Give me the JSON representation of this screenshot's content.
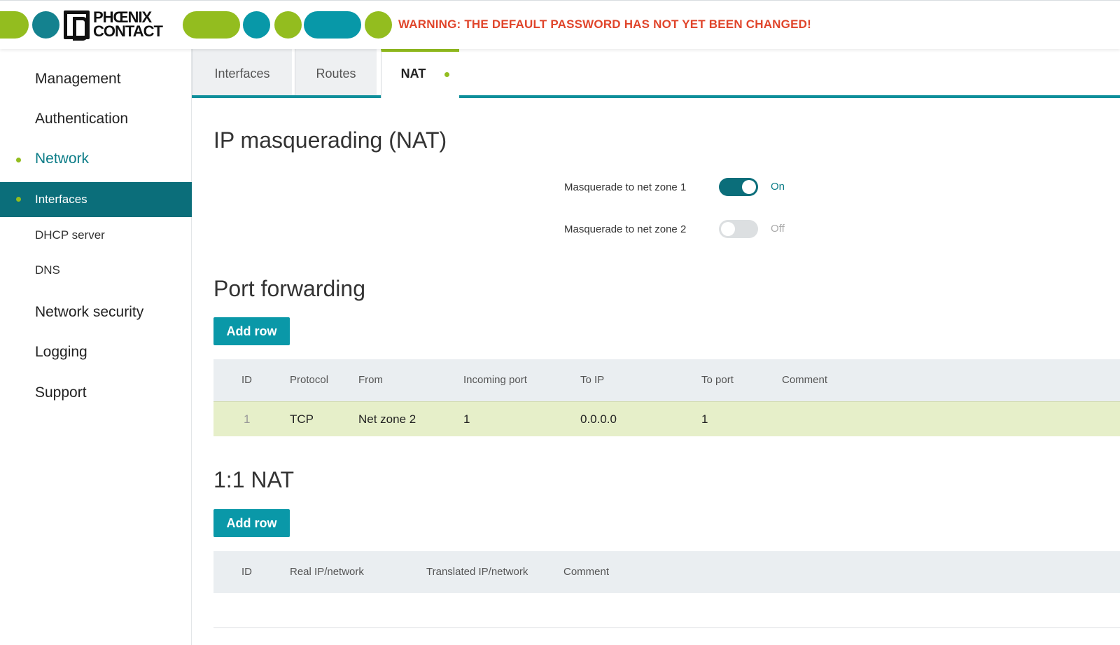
{
  "header": {
    "brand_line1": "PHŒNIX",
    "brand_line2": "CONTACT",
    "warning": "WARNING: THE DEFAULT PASSWORD HAS NOT YET BEEN CHANGED!",
    "colors": {
      "green": "#93bd1f",
      "teal": "#14828f",
      "warning": "#e0452b"
    }
  },
  "sidebar": {
    "items": [
      {
        "label": "Management"
      },
      {
        "label": "Authentication"
      },
      {
        "label": "Network"
      },
      {
        "label": "Interfaces"
      },
      {
        "label": "DHCP server"
      },
      {
        "label": "DNS"
      },
      {
        "label": "Network security"
      },
      {
        "label": "Logging"
      },
      {
        "label": "Support"
      }
    ]
  },
  "tabs": [
    {
      "label": "Interfaces"
    },
    {
      "label": "Routes"
    },
    {
      "label": "NAT"
    }
  ],
  "masquerading": {
    "title": "IP masquerading (NAT)",
    "zone1": {
      "label": "Masquerade to net zone 1",
      "state": "On"
    },
    "zone2": {
      "label": "Masquerade to net zone 2",
      "state": "Off"
    }
  },
  "port_forwarding": {
    "title": "Port forwarding",
    "add_label": "Add row",
    "columns": [
      "ID",
      "Protocol",
      "From",
      "Incoming port",
      "To IP",
      "To port",
      "Comment"
    ],
    "rows": [
      {
        "id": "1",
        "protocol": "TCP",
        "from": "Net zone 2",
        "incoming_port": "1",
        "to_ip": "0.0.0.0",
        "to_port": "1",
        "comment": ""
      }
    ]
  },
  "one_to_one_nat": {
    "title": "1:1 NAT",
    "add_label": "Add row",
    "columns": [
      "ID",
      "Real IP/network",
      "Translated IP/network",
      "Comment"
    ]
  }
}
